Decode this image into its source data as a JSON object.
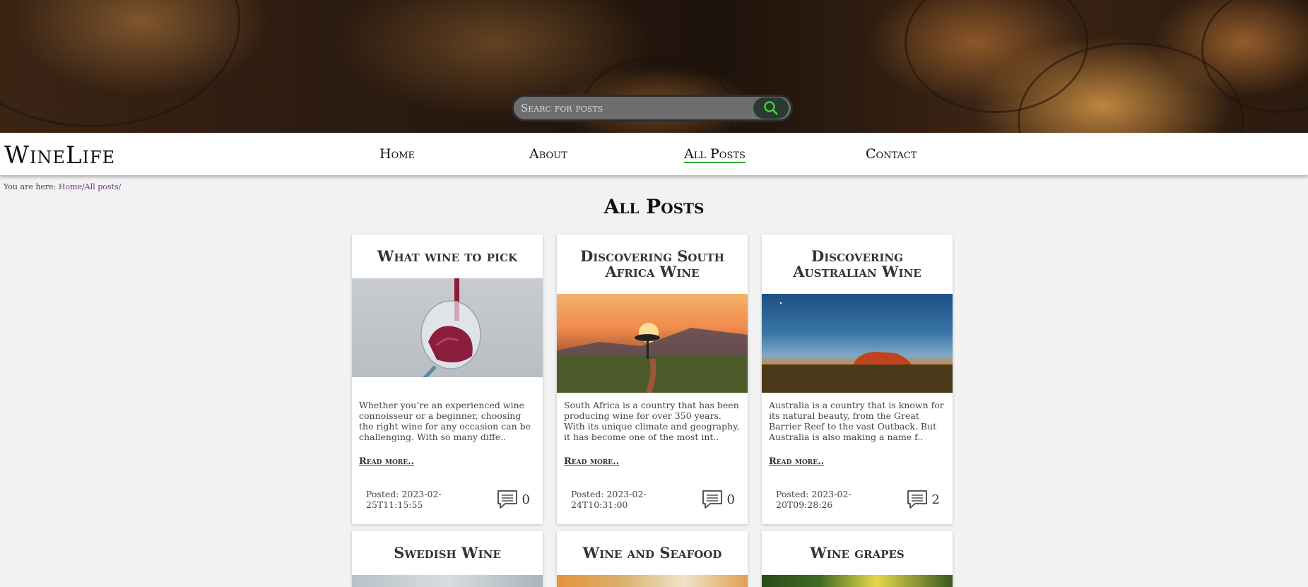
{
  "site": {
    "logo": "WineLife",
    "search_placeholder": "Searc for posts"
  },
  "nav": {
    "items": [
      {
        "label": "Home"
      },
      {
        "label": "About"
      },
      {
        "label": "All Posts",
        "active": true
      },
      {
        "label": "Contact"
      }
    ]
  },
  "breadcrumb": {
    "prefix": "You are here: ",
    "path": "Home/All posts/"
  },
  "page_title": "All Posts",
  "posts": [
    {
      "title": "What wine to pick",
      "excerpt": "Whether you’re an experienced wine connoisseur or a beginner, choosing the right wine for any occasion can be challenging. With so many diffe..",
      "read_more": "Read more..",
      "posted_line1": "Posted: 2023-02-",
      "posted_line2": "25T11:15:55",
      "comments": "0"
    },
    {
      "title": "Discovering South Africa Wine",
      "excerpt": "South Africa is a country that has been producing wine for over 350 years. With its unique climate and geography, it has become one of the most int..",
      "read_more": "Read more..",
      "posted_line1": "Posted: 2023-02-",
      "posted_line2": "24T10:31:00",
      "comments": "0"
    },
    {
      "title": "Discovering Australian Wine",
      "excerpt": "Australia is a country that is known for its natural beauty, from the Great Barrier Reef to the vast Outback. But Australia is also making a name f..",
      "read_more": "Read more..",
      "posted_line1": "Posted: 2023-02-",
      "posted_line2": "20T09:28:26",
      "comments": "2"
    },
    {
      "title": "Swedish Wine"
    },
    {
      "title": "Wine and Seafood"
    },
    {
      "title": "Wine grapes"
    }
  ],
  "colors": {
    "accent": "#2ea82e",
    "background": "#f2f2f2",
    "card": "#ffffff"
  }
}
